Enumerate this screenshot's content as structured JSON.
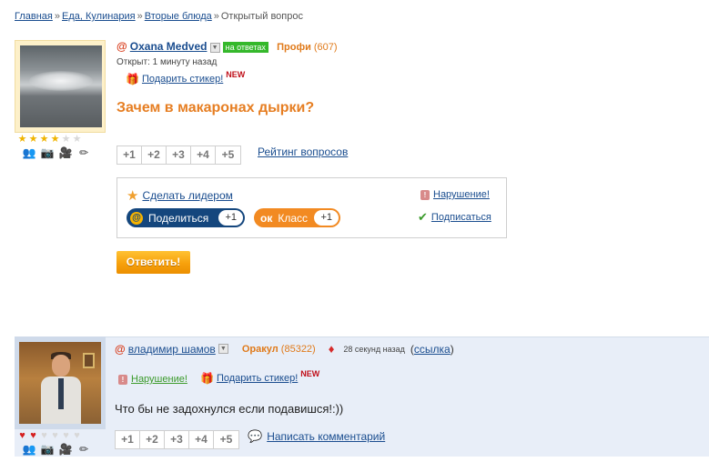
{
  "breadcrumb": {
    "items": [
      "Главная",
      "Еда, Кулинария",
      "Вторые блюда"
    ],
    "current": "Открытый вопрос",
    "separator": "»"
  },
  "question": {
    "author": "Oxana Medved",
    "status_badge": "на ответах",
    "rank": "Профи",
    "score": "(607)",
    "opened": "Открыт: 1 минуту назад",
    "gift_label": "Подарить стикер!",
    "new_label": "NEW",
    "title": "Зачем в макаронах дырки?",
    "stars_on": 4,
    "stars_total": 6,
    "votes": [
      "+1",
      "+2",
      "+3",
      "+4",
      "+5"
    ],
    "rating_link": "Рейтинг вопросов",
    "make_leader": "Сделать лидером",
    "share_label": "Поделиться",
    "share_count": "+1",
    "class_label": "Класс",
    "class_count": "+1",
    "violation": "Нарушение!",
    "subscribe": "Подписаться",
    "answer_button": "Ответить!"
  },
  "answer": {
    "author": "владимир шамов",
    "rank": "Оракул",
    "score": "(85322)",
    "time": "28 секунд назад",
    "link_label": "ссылка",
    "violation": "Нарушение!",
    "gift_label": "Подарить стикер!",
    "new_label": "NEW",
    "text": "Что бы не задохнулся если подавишся!:))",
    "hearts_on": 2,
    "hearts_total": 6,
    "votes": [
      "+1",
      "+2",
      "+3",
      "+4",
      "+5"
    ],
    "comment_link": "Написать комментарий"
  },
  "colors": {
    "accent_orange": "#e67e22",
    "link_blue": "#1a4d8f",
    "answer_bg": "#e8eef8",
    "status_green": "#35b82b"
  },
  "icons": [
    "mail-at-icon",
    "dropdown-icon",
    "gift-icon",
    "star-icon",
    "heart-icon",
    "friends-icon",
    "photo-icon",
    "video-icon",
    "edit-icon",
    "warning-icon",
    "subscribe-icon",
    "diamond-icon",
    "comment-bubble-icon"
  ]
}
